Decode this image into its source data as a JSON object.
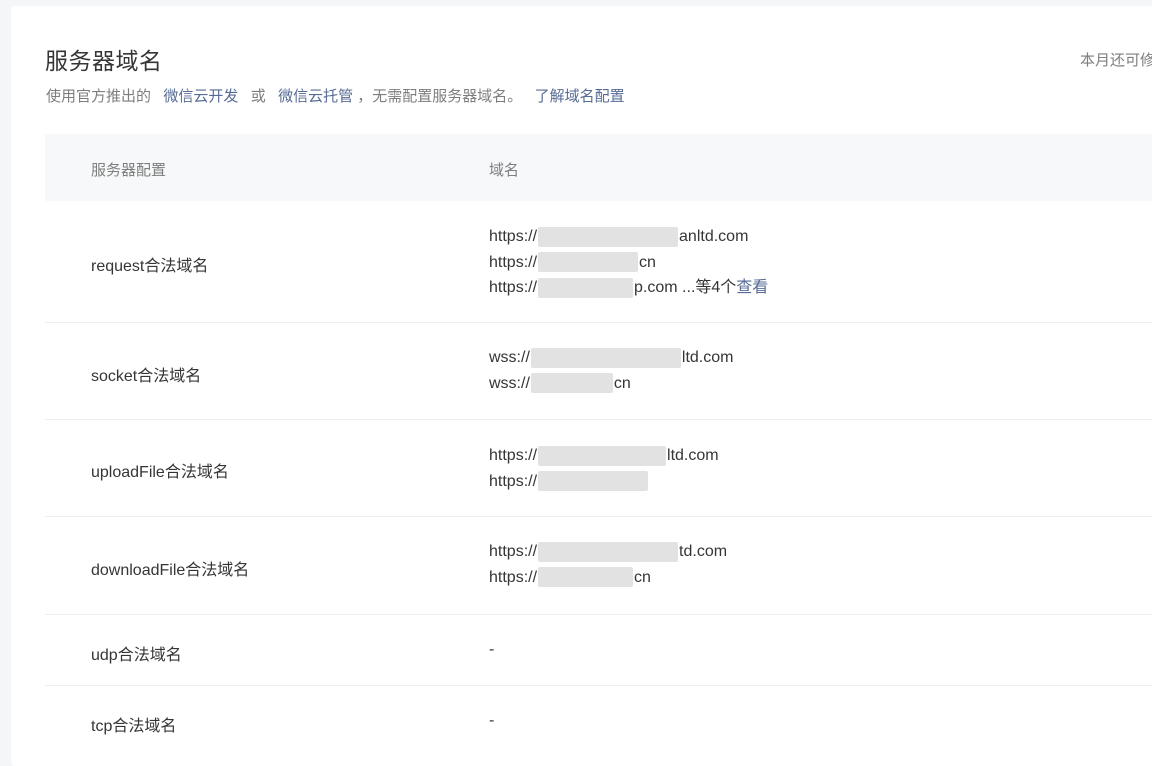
{
  "page": {
    "title": "服务器域名",
    "quota": "本月还可修",
    "subtitle": {
      "prefix": "使用官方推出的",
      "link_cloud_dev": "微信云开发",
      "or": "或",
      "link_cloud_host": "微信云托管",
      "suffix": "，无需配置服务器域名。",
      "learn_link": "了解域名配置"
    }
  },
  "table": {
    "headers": {
      "config": "服务器配置",
      "domain": "域名"
    },
    "rows": [
      {
        "label": "request合法域名",
        "domains": [
          {
            "pre": "https://",
            "mask": 140,
            "post": "anltd.com"
          },
          {
            "pre": "https://",
            "mask": 100,
            "post": "cn"
          },
          {
            "pre": "https://",
            "mask": 95,
            "post": "p.com"
          }
        ],
        "more_text": " ...等4个",
        "more_link": "查看"
      },
      {
        "label": "socket合法域名",
        "domains": [
          {
            "pre": "wss://",
            "mask": 150,
            "post": "ltd.com"
          },
          {
            "pre": "wss://",
            "mask": 82,
            "post": "cn"
          }
        ]
      },
      {
        "label": "uploadFile合法域名",
        "domains": [
          {
            "pre": "https://",
            "mask": 128,
            "post": "ltd.com"
          },
          {
            "pre": "https://",
            "mask": 110,
            "post": ""
          }
        ]
      },
      {
        "label": "downloadFile合法域名",
        "domains": [
          {
            "pre": "https://",
            "mask": 140,
            "post": "td.com"
          },
          {
            "pre": "https://",
            "mask": 95,
            "post": "cn"
          }
        ]
      },
      {
        "label": "udp合法域名",
        "value": "-"
      },
      {
        "label": "tcp合法域名",
        "value": "-"
      }
    ]
  }
}
